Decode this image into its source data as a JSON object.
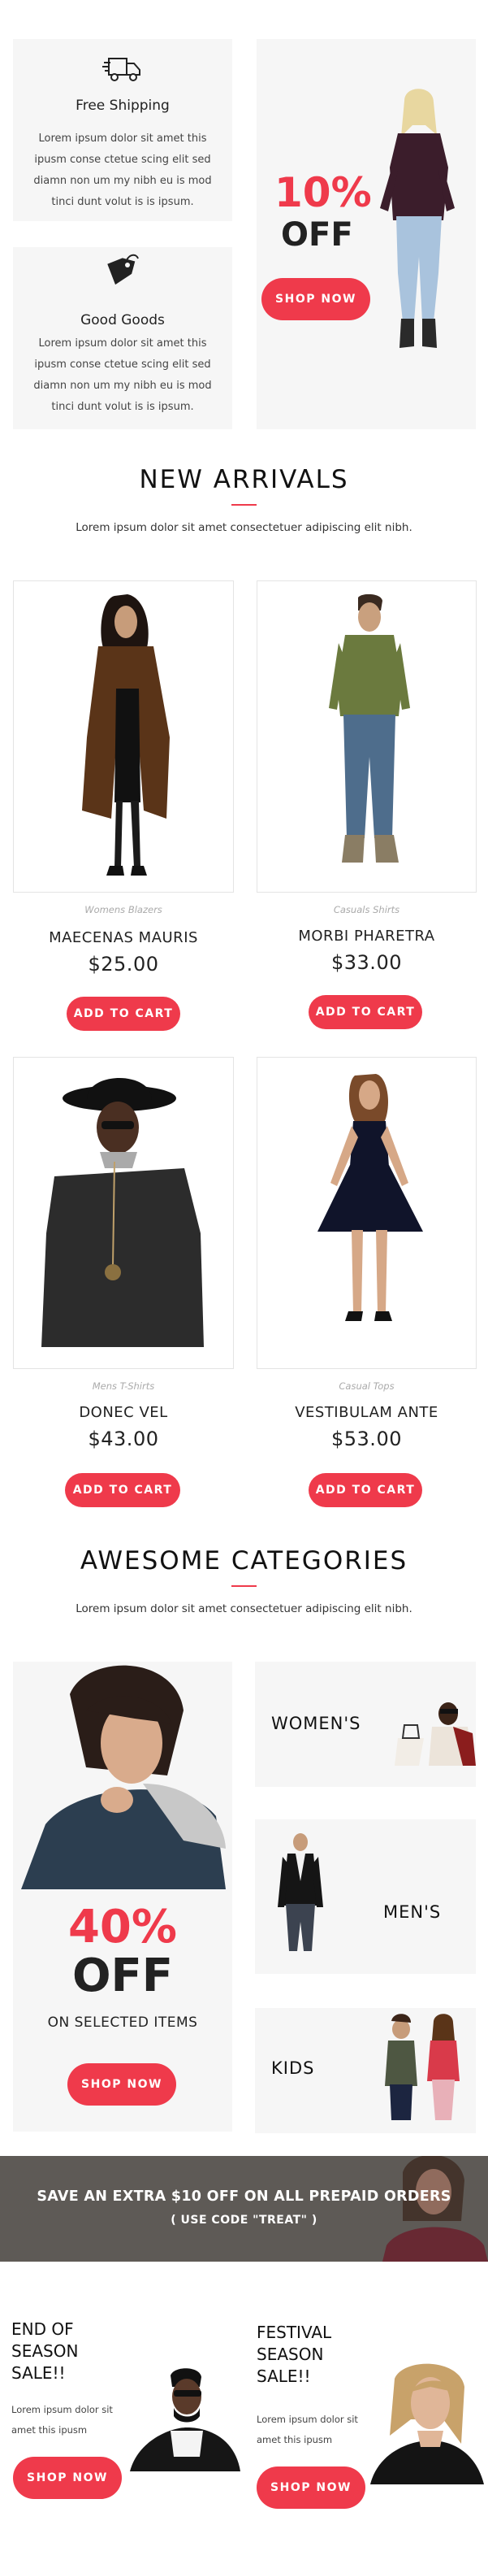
{
  "features": [
    {
      "icon": "delivery-truck-icon",
      "title": "Free Shipping",
      "text": "Lorem ipsum dolor sit amet this ipusm conse ctetue scing elit sed diamn non um my nibh eu is mod tinci dunt volut is is ipsum."
    },
    {
      "icon": "price-tag-icon",
      "title": "Good Goods",
      "text": "Lorem ipsum dolor sit amet this ipusm conse ctetue scing elit sed diamn non um my nibh eu is mod tinci dunt volut is is ipsum."
    }
  ],
  "promo": {
    "percent": "10%",
    "off": "OFF",
    "button": "SHOP NOW"
  },
  "arrivals": {
    "title": "NEW ARRIVALS",
    "subtitle": "Lorem ipsum dolor sit amet consectetuer adipiscing elit nibh.",
    "products": [
      {
        "category": "Womens Blazers",
        "name": "MAECENAS MAURIS",
        "price": "$25.00",
        "button": "ADD TO CART"
      },
      {
        "category": "Casuals Shirts",
        "name": "MORBI PHARETRA",
        "price": "$33.00",
        "button": "ADD TO CART"
      },
      {
        "category": "Mens T-Shirts",
        "name": "DONEC VEL",
        "price": "$43.00",
        "button": "ADD TO CART"
      },
      {
        "category": "Casual Tops",
        "name": "VESTIBULAM ANTE",
        "price": "$53.00",
        "button": "ADD TO CART"
      }
    ]
  },
  "categories": {
    "title": "AWESOME CATEGORIES",
    "subtitle": "Lorem ipsum dolor sit amet consectetuer adipiscing elit nibh.",
    "big_promo": {
      "percent": "40%",
      "off": "OFF",
      "caption": "ON SELECTED ITEMS",
      "button": "SHOP NOW"
    },
    "items": [
      {
        "label": "WOMEN'S"
      },
      {
        "label": "MEN'S"
      },
      {
        "label": "KIDS"
      }
    ]
  },
  "banner": {
    "headline": "SAVE AN EXTRA $10 OFF ON ALL PREPAID ORDERS",
    "code": "( USE CODE \"TREAT\" )"
  },
  "sales": [
    {
      "title_lines": [
        "END OF",
        "SEASON",
        "SALE!!"
      ],
      "text_lines": [
        "Lorem ipsum dolor sit",
        "amet this ipusm"
      ],
      "button": "SHOP NOW"
    },
    {
      "title_lines": [
        "FESTIVAL",
        "SEASON",
        "SALE!!"
      ],
      "text_lines": [
        "Lorem ipsum dolor sit",
        "amet this ipusm"
      ],
      "button": "SHOP NOW"
    }
  ],
  "colors": {
    "accent": "#ef3a4b",
    "panel": "#f6f6f6",
    "banner_overlay": "#5e5a56"
  }
}
